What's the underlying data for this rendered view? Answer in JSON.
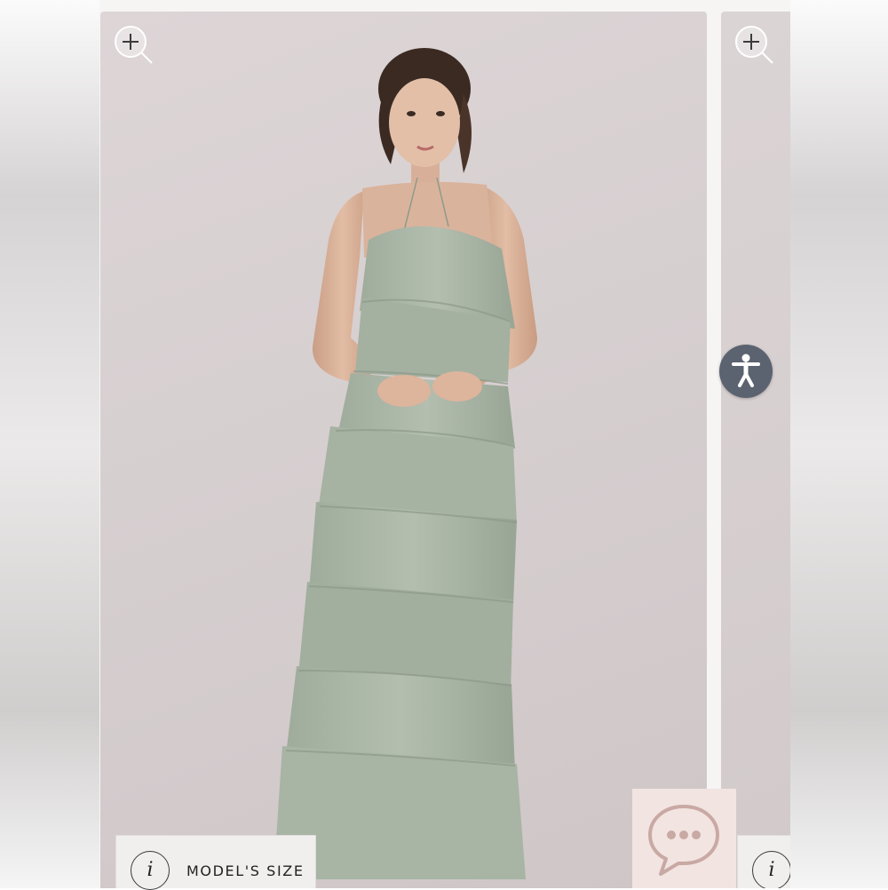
{
  "gallery": {
    "main_image": {
      "alt": "",
      "zoom_icon": "zoom-in-icon"
    },
    "next_image": {
      "zoom_icon": "zoom-in-icon"
    }
  },
  "model_size": {
    "info_icon_glyph": "i",
    "label": "MODEL'S SIZE"
  },
  "next_info": {
    "info_icon_glyph": "i"
  },
  "accessibility": {
    "icon": "accessibility-icon",
    "color": "#5b6270"
  },
  "chat": {
    "icon": "chat-bubble-icon",
    "color": "#c9a9a4"
  },
  "colors": {
    "card_bg": "#d6cfd0",
    "dress": "#a9b5a6",
    "chat_bg": "#f2e4e1"
  }
}
